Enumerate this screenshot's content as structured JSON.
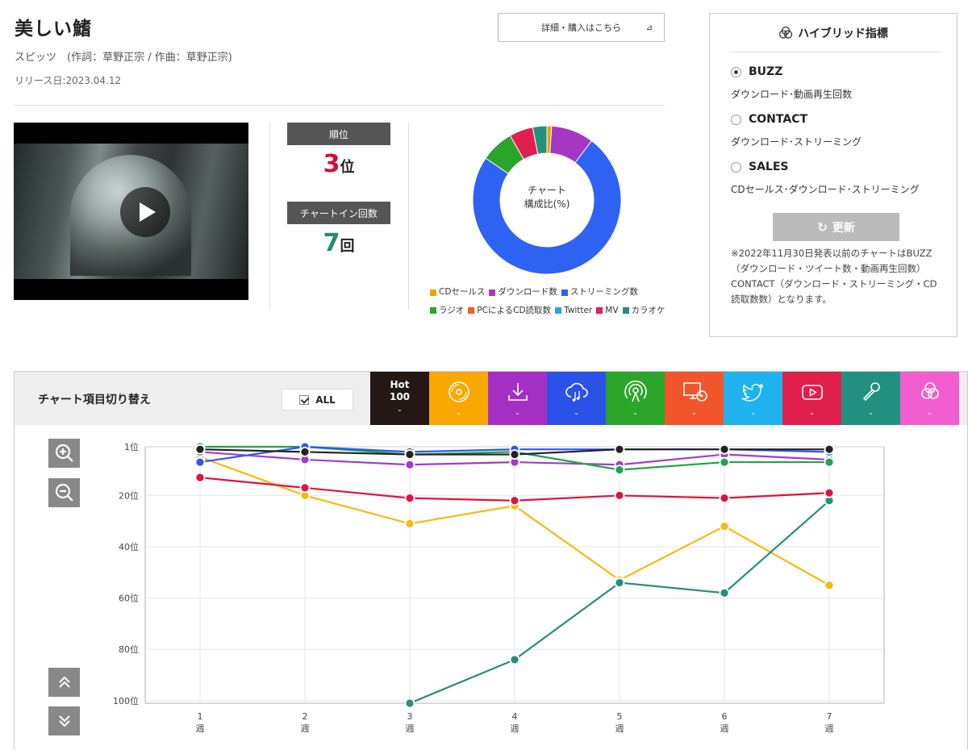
{
  "song": {
    "title": "美しい鰭",
    "artist_line": "スピッツ　(作詞：草野正宗 / 作曲：草野正宗)",
    "release": "リリース日:2023.04.12",
    "detail_button": "詳細・購入はこちら"
  },
  "stats": {
    "rank_label": "順位",
    "rank_value": "3",
    "rank_unit": "位",
    "rank_color": "#d0103a",
    "chartin_label": "チャートイン回数",
    "chartin_value": "7",
    "chartin_unit": "回",
    "chartin_color": "#2a8a6f"
  },
  "donut": {
    "center_line1": "チャート",
    "center_line2": "構成比(%)",
    "slices": [
      {
        "name": "CDセールス",
        "value": 1,
        "color": "#f5a000"
      },
      {
        "name": "ダウンロード数",
        "value": 9,
        "color": "#a637c4"
      },
      {
        "name": "ストリーミング数",
        "value": 72,
        "color": "#2e62f2"
      },
      {
        "name": "ラジオ",
        "value": 7,
        "color": "#2aa52a"
      },
      {
        "name": "PCによるCD読取数",
        "value": 0,
        "color": "#f25a28"
      },
      {
        "name": "Twitter",
        "value": 0,
        "color": "#22a8e8"
      },
      {
        "name": "MV",
        "value": 5,
        "color": "#e21e50"
      },
      {
        "name": "カラオケ",
        "value": 3,
        "color": "#249080"
      }
    ]
  },
  "hybrid": {
    "title": "ハイブリッド指標",
    "options": [
      {
        "label": "BUZZ",
        "desc": "ダウンロード･動画再生回数",
        "selected": true
      },
      {
        "label": "CONTACT",
        "desc": "ダウンロード･ストリーミング",
        "selected": false
      },
      {
        "label": "SALES",
        "desc": "CDセールス･ダウンロード･ストリーミング",
        "selected": false
      }
    ],
    "update_label": "更新",
    "note": "※2022年11月30日発表以前のチャートはBUZZ（ダウンロード・ツイート数・動画再生回数）CONTACT（ダウンロード・ストリーミング・CD読取数数）となります。"
  },
  "chart_switch": {
    "label": "チャート項目切り替え",
    "all_label": "ALL",
    "hot_line1": "Hot",
    "hot_line2": "100",
    "tabs": [
      {
        "icon": "hot100",
        "color": "#231815"
      },
      {
        "icon": "cd-icon",
        "color": "#f9a800"
      },
      {
        "icon": "download-icon",
        "color": "#a42fc2"
      },
      {
        "icon": "streaming-icon",
        "color": "#2b52e8"
      },
      {
        "icon": "radio-icon",
        "color": "#2ba62b"
      },
      {
        "icon": "pc-cd-read-icon",
        "color": "#f2542c"
      },
      {
        "icon": "twitter-icon",
        "color": "#20b2ef"
      },
      {
        "icon": "youtube-icon",
        "color": "#e11f4d"
      },
      {
        "icon": "karaoke-icon",
        "color": "#229080"
      },
      {
        "icon": "hybrid-icon",
        "color": "#f25ecf"
      }
    ]
  },
  "chart_data": {
    "type": "line",
    "x": [
      "1",
      "2",
      "3",
      "4",
      "5",
      "6",
      "7"
    ],
    "x_unit": "週",
    "y_tick_labels": [
      "1位",
      "20位",
      "40位",
      "60位",
      "80位",
      "100位"
    ],
    "y_ticks": [
      1,
      20,
      40,
      60,
      80,
      100
    ],
    "ylim": [
      1,
      101
    ],
    "y_inverted": true,
    "grid": true,
    "series": [
      {
        "key": "cd",
        "color": "#f9b90b",
        "values": [
          5,
          20,
          31,
          24,
          53,
          32,
          55
        ]
      },
      {
        "key": "karaoke",
        "color": "#248f7c",
        "values": [
          null,
          null,
          101,
          84,
          54,
          58,
          22
        ]
      },
      {
        "key": "mv",
        "color": "#e2123f",
        "values": [
          13,
          17,
          21,
          22,
          20,
          21,
          19
        ]
      },
      {
        "key": "download",
        "color": "#a53cc8",
        "values": [
          3,
          6,
          8,
          7,
          8,
          4,
          6
        ]
      },
      {
        "key": "radio",
        "color": "#1fa548",
        "values": [
          1,
          1,
          4,
          3,
          10,
          7,
          7
        ]
      },
      {
        "key": "streaming",
        "color": "#2c57f0",
        "values": [
          7,
          1,
          3,
          2,
          2,
          2,
          3
        ]
      },
      {
        "key": "hot100",
        "color": "#222222",
        "values": [
          2,
          3,
          4,
          4,
          2,
          2,
          2
        ]
      }
    ]
  }
}
